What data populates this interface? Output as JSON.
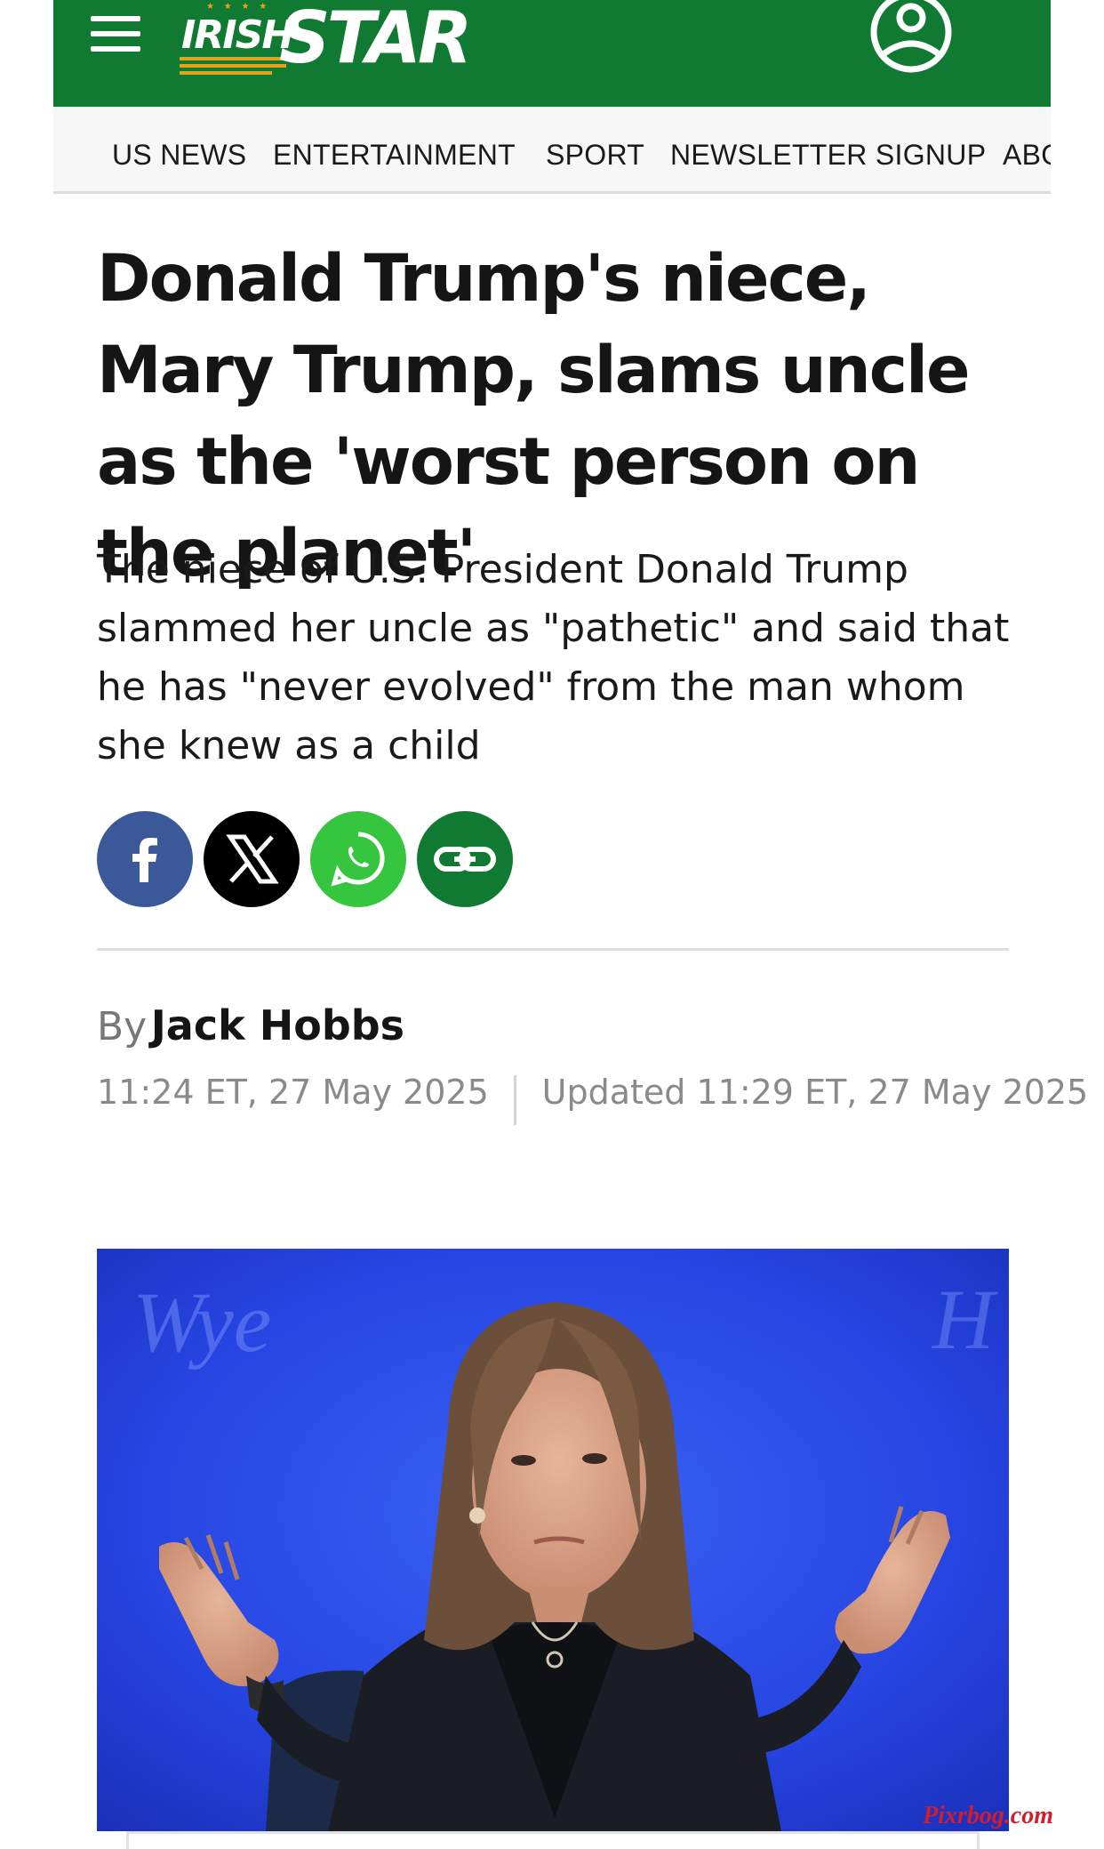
{
  "brand": {
    "name_part1": "IRISH",
    "name_part2": "STAR",
    "header_color": "#117a32",
    "accent_color": "#e8a21a"
  },
  "header": {
    "menu_icon": "hamburger-menu-icon",
    "account_icon": "user-account-icon"
  },
  "nav": {
    "items": [
      {
        "label": "US NEWS"
      },
      {
        "label": "ENTERTAINMENT"
      },
      {
        "label": "SPORT"
      },
      {
        "label": "NEWSLETTER SIGNUP"
      },
      {
        "label": "ABOUT US"
      }
    ]
  },
  "article": {
    "headline": "Donald Trump's niece, Mary Trump, slams uncle as the 'worst person on the planet'",
    "standfirst": "The niece of U.S. President Donald Trump slammed her uncle as \"pathetic\" and said that he has \"never evolved\" from the man whom she knew as a child",
    "share": [
      {
        "icon": "facebook-icon",
        "color": "#3b5998"
      },
      {
        "icon": "x-twitter-icon",
        "color": "#000000"
      },
      {
        "icon": "whatsapp-icon",
        "color": "#35c53f"
      },
      {
        "icon": "copy-link-icon",
        "color": "#117a32"
      }
    ],
    "byline_prefix": "By",
    "author": "Jack Hobbs",
    "published": "11:24 ET, 27 May 2025",
    "updated": "Updated 11:29 ET, 27 May 2025",
    "hero_backdrop_text_left": "Wye",
    "hero_backdrop_text_right": "H"
  },
  "watermark": "Pixrbog.com"
}
